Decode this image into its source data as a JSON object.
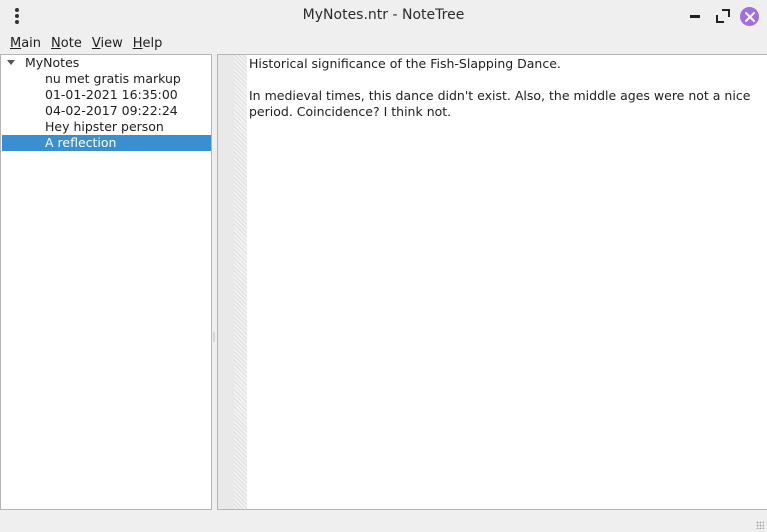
{
  "window": {
    "title": "MyNotes.ntr - NoteTree"
  },
  "menubar": {
    "items": [
      {
        "prefix": "",
        "mnemonic": "M",
        "rest": "ain"
      },
      {
        "prefix": "",
        "mnemonic": "N",
        "rest": "ote"
      },
      {
        "prefix": "",
        "mnemonic": "V",
        "rest": "iew"
      },
      {
        "prefix": "",
        "mnemonic": "H",
        "rest": "elp"
      }
    ]
  },
  "tree": {
    "root": "MyNotes",
    "children": [
      "nu met gratis markup",
      "01-01-2021 16:35:00",
      "04-02-2017 09:22:24",
      "Hey hipster person",
      "A reflection"
    ],
    "selected_index": 4
  },
  "editor": {
    "line1": "Historical significance of the Fish-Slapping Dance.",
    "line2": "In medieval times, this dance didn't exist. Also, the middle ages were not a nice",
    "line3": "period. Coincidence? I think not."
  },
  "colors": {
    "selection": "#3a8fd0",
    "close_button": "#9f6ee0"
  },
  "icons": {
    "menu": "kebab-menu-icon",
    "minimize": "minimize-icon",
    "maximize": "maximize-icon",
    "close": "close-icon",
    "expand": "chevron-down-icon"
  }
}
